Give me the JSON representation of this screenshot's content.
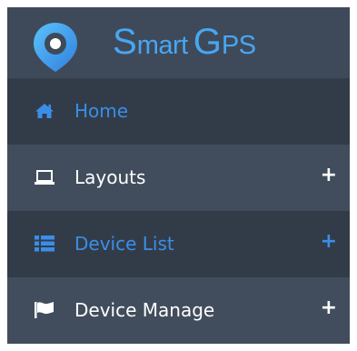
{
  "brand": {
    "initial1": "S",
    "rest1": "mart",
    "initial2": "G",
    "rest2": "PS"
  },
  "nav": {
    "items": [
      {
        "label": "Home",
        "icon": "home-icon",
        "expandable": false,
        "active": true
      },
      {
        "label": "Layouts",
        "icon": "laptop-icon",
        "expandable": true,
        "expand_symbol": "+",
        "active": false
      },
      {
        "label": "Device List",
        "icon": "list-icon",
        "expandable": true,
        "expand_symbol": "+",
        "active": true
      },
      {
        "label": "Device Manage",
        "icon": "flag-icon",
        "expandable": true,
        "expand_symbol": "+",
        "active": false
      }
    ]
  },
  "colors": {
    "sidebar_bg": "#3e4a5a",
    "active_bg": "#323c49",
    "accent": "#3b8ee8",
    "brand": "#48a6f2",
    "text": "#ffffff"
  }
}
